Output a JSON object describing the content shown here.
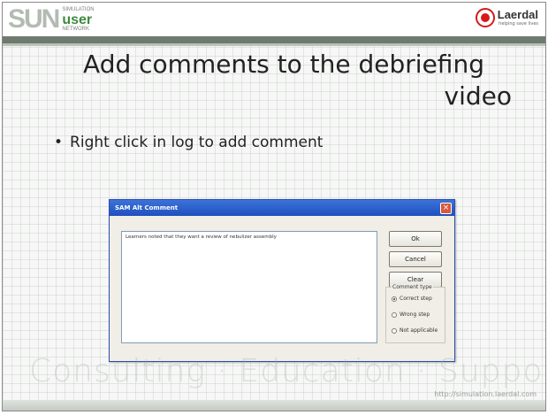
{
  "header": {
    "logo_sun": "SUN",
    "logo_small_top": "SIMULATION",
    "logo_user": "user",
    "logo_small_bottom": "NETWORK",
    "brand_name": "Laerdal",
    "brand_tagline": "helping save lives"
  },
  "slide": {
    "title_line1": "Add comments to the debriefing",
    "title_line2": "video",
    "bullet": "Right click in log to add comment"
  },
  "dialog": {
    "title": "SAM Alt Comment",
    "close_glyph": "×",
    "comment_text": "Learners noted that they want a review of nebulizer assembly",
    "buttons": {
      "ok": "Ok",
      "cancel": "Cancel",
      "clear": "Clear"
    },
    "comment_type": {
      "label": "Comment type",
      "options": [
        {
          "label": "Correct step",
          "selected": true
        },
        {
          "label": "Wrong step",
          "selected": false
        },
        {
          "label": "Not applicable",
          "selected": false
        }
      ]
    }
  },
  "footer": {
    "tagline": "Consulting  ·  Education  ·  Support",
    "url": "http://simulation.laerdal.com"
  },
  "colors": {
    "accent_green": "#3d8a3d",
    "laerdal_red": "#d41a1a",
    "titlebar_blue": "#2a5ccc"
  }
}
